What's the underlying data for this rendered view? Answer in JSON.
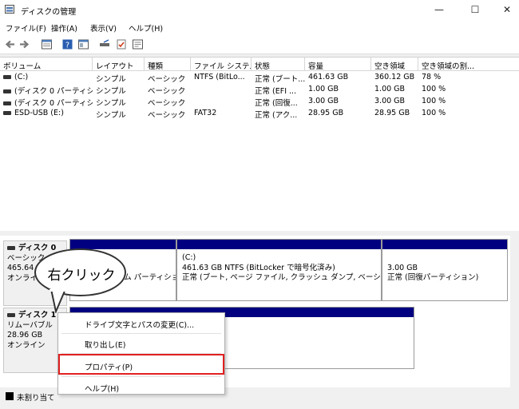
{
  "window": {
    "title": "ディスクの管理",
    "controls": {
      "minimize": "—",
      "maximize": "☐",
      "close": "✕"
    }
  },
  "menu": [
    "ファイル(F)",
    "操作(A)",
    "表示(V)",
    "ヘルプ(H)"
  ],
  "toolbar_icons": [
    "back-icon",
    "forward-icon",
    "list-view-icon",
    "help-icon",
    "properties-icon",
    "drive-icon",
    "check-icon",
    "settings-icon"
  ],
  "volumes": {
    "columns": [
      "ボリューム",
      "レイアウト",
      "種類",
      "ファイル システム",
      "状態",
      "容量",
      "空き領域",
      "空き領域の割..."
    ],
    "rows": [
      [
        "(C:)",
        "シンプル",
        "ベーシック",
        "NTFS (BitLo...",
        "正常 (ブート...",
        "461.63 GB",
        "360.12 GB",
        "78 %"
      ],
      [
        "(ディスク 0 パーティシ...",
        "シンプル",
        "ベーシック",
        "",
        "正常 (EFI ...",
        "1.00 GB",
        "1.00 GB",
        "100 %"
      ],
      [
        "(ディスク 0 パーティシ...",
        "シンプル",
        "ベーシック",
        "",
        "正常 (回復...",
        "3.00 GB",
        "3.00 GB",
        "100 %"
      ],
      [
        "ESD-USB (E:)",
        "シンプル",
        "ベーシック",
        "FAT32",
        "正常 (アク...",
        "28.95 GB",
        "28.95 GB",
        "100 %"
      ]
    ]
  },
  "disks": [
    {
      "name": "ディスク 0",
      "type": "ベーシック",
      "size": "465.64 GB",
      "status": "オンライ",
      "partitions": [
        {
          "line1": "",
          "line2": "",
          "line3": "テム パーティショ"
        },
        {
          "line1": "(C:)",
          "line2": "461.63 GB NTFS (BitLocker で暗号化済み)",
          "line3": "正常 (ブート, ページ ファイル, クラッシュ ダンプ, ベーシック デー"
        },
        {
          "line1": "",
          "line2": "3.00 GB",
          "line3": "正常 (回復パーティション)"
        }
      ]
    },
    {
      "name": "ディスク 1",
      "type": "リムーバブル",
      "size": "28.96 GB",
      "status": "オンライン"
    }
  ],
  "status": {
    "legend": "未割り当て"
  },
  "callout": {
    "text": "右クリック"
  },
  "context_menu": {
    "items": [
      "ドライブ文字とパスの変更(C)...",
      "取り出し(E)",
      "プロパティ(P)",
      "ヘルプ(H)"
    ]
  }
}
